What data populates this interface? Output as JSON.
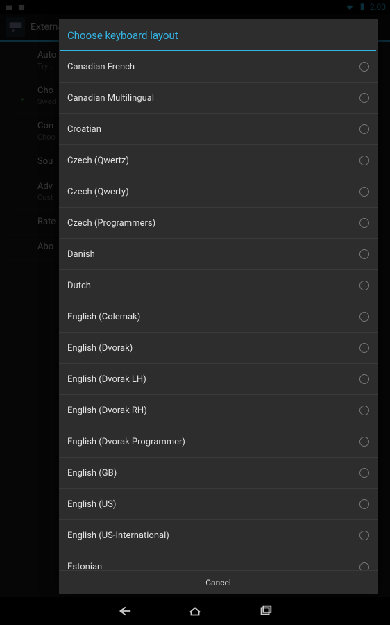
{
  "status_bar": {
    "time": "2:00"
  },
  "app_bar": {
    "title": "External"
  },
  "settings": {
    "items": [
      {
        "title": "Auto",
        "sub": "Try t",
        "chevron": false,
        "checkbox": false
      },
      {
        "title": "Cho",
        "sub": "Swed",
        "chevron": true,
        "checkbox": false
      },
      {
        "title": "Con",
        "sub": "Choo",
        "chevron": false,
        "checkbox": false
      },
      {
        "title": "Sou",
        "sub": "",
        "chevron": false,
        "checkbox": true
      },
      {
        "title": "Adv",
        "sub": "Cust",
        "chevron": false,
        "checkbox": false
      },
      {
        "title": "Rate",
        "sub": "",
        "chevron": false,
        "checkbox": false
      },
      {
        "title": "Abo",
        "sub": "",
        "chevron": false,
        "checkbox": false
      }
    ]
  },
  "dialog": {
    "title": "Choose keyboard layout",
    "cancel": "Cancel",
    "layouts": [
      "Canadian French",
      "Canadian Multilingual",
      "Croatian",
      "Czech (Qwertz)",
      "Czech (Qwerty)",
      "Czech (Programmers)",
      "Danish",
      "Dutch",
      "English (Colemak)",
      "English (Dvorak)",
      "English (Dvorak LH)",
      "English (Dvorak RH)",
      "English (Dvorak Programmer)",
      "English (GB)",
      "English (US)",
      "English (US-International)",
      "Estonian"
    ]
  }
}
